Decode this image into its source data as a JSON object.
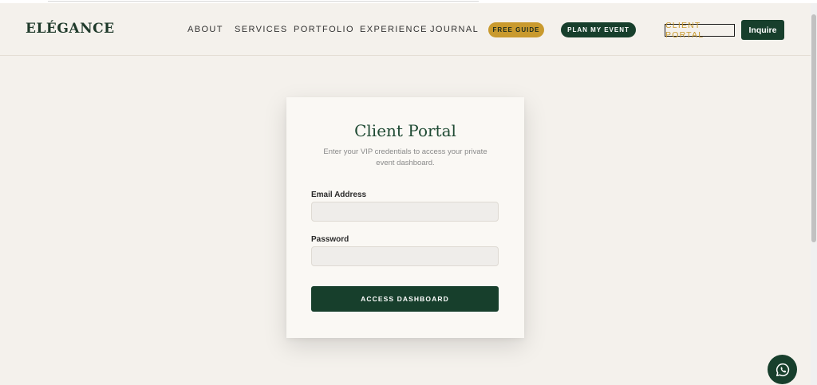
{
  "header": {
    "logo": "ELÉGANCE",
    "nav": [
      "ABOUT",
      "SERVICES",
      "PORTFOLIO",
      "EXPERIENCE",
      "JOURNAL"
    ],
    "free_guide": "FREE GUIDE",
    "plan_event": "PLAN MY EVENT",
    "client_portal": "CLIENT PORTAL",
    "inquire": "Inquire"
  },
  "card": {
    "title": "Client Portal",
    "subtitle": "Enter your VIP credentials to access your private event dashboard.",
    "email_label": "Email Address",
    "email_value": "",
    "password_label": "Password",
    "password_value": "",
    "submit": "ACCESS DASHBOARD"
  },
  "icons": {
    "whatsapp": "whatsapp-icon"
  },
  "colors": {
    "brand_green": "#173f2c",
    "accent_gold": "#c99a2e",
    "background": "#f4f1ec"
  }
}
